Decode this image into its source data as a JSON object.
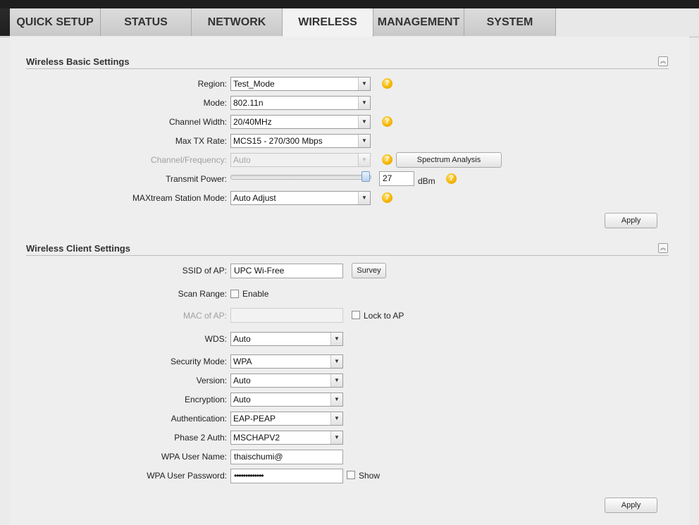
{
  "tabs": [
    {
      "label": "QUICK SETUP",
      "active": false
    },
    {
      "label": "STATUS",
      "active": false
    },
    {
      "label": "NETWORK",
      "active": false
    },
    {
      "label": "WIRELESS",
      "active": true
    },
    {
      "label": "MANAGEMENT",
      "active": false
    },
    {
      "label": "SYSTEM",
      "active": false
    }
  ],
  "basic": {
    "title": "Wireless Basic Settings",
    "collapse_icon": "double-chevron-up-icon",
    "region_label": "Region:",
    "region_value": "Test_Mode",
    "mode_label": "Mode:",
    "mode_value": "802.11n",
    "channel_width_label": "Channel Width:",
    "channel_width_value": "20/40MHz",
    "max_tx_label": "Max TX Rate:",
    "max_tx_value": "MCS15 - 270/300 Mbps",
    "channel_freq_label": "Channel/Frequency:",
    "channel_freq_value": "Auto",
    "spectrum_button": "Spectrum Analysis",
    "transmit_power_label": "Transmit Power:",
    "transmit_power_value": "27",
    "transmit_power_fraction": 1.0,
    "transmit_power_unit": "dBm",
    "maxtream_label": "MAXtream Station Mode:",
    "maxtream_value": "Auto Adjust",
    "apply_label": "Apply",
    "help_glyph": "?"
  },
  "client": {
    "title": "Wireless Client Settings",
    "collapse_icon": "double-chevron-up-icon",
    "ssid_label": "SSID of AP:",
    "ssid_value": "UPC Wi-Free",
    "survey_button": "Survey",
    "scan_range_label": "Scan Range:",
    "scan_range_enable": "Enable",
    "scan_range_checked": false,
    "mac_label": "MAC of AP:",
    "mac_value": "",
    "lock_label": "Lock to AP",
    "lock_checked": false,
    "wds_label": "WDS:",
    "wds_value": "Auto",
    "security_label": "Security Mode:",
    "security_value": "WPA",
    "version_label": "Version:",
    "version_value": "Auto",
    "encryption_label": "Encryption:",
    "encryption_value": "Auto",
    "auth_label": "Authentication:",
    "auth_value": "EAP-PEAP",
    "phase2_label": "Phase 2 Auth:",
    "phase2_value": "MSCHAPV2",
    "wpa_user_label": "WPA User Name:",
    "wpa_user_value": "thaischumi@",
    "wpa_pass_label": "WPA User Password:",
    "wpa_pass_value": "•••••••••••••",
    "show_label": "Show",
    "show_checked": false,
    "apply_label": "Apply"
  }
}
